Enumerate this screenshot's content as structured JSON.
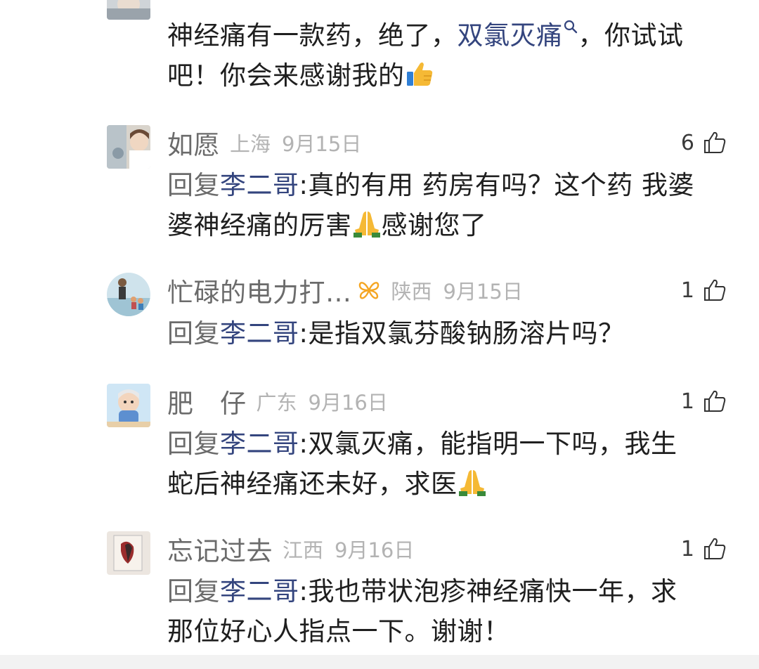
{
  "top_comment": {
    "text_a": "神经痛有一款药，绝了，",
    "drug_link": "双氯灭痛",
    "text_b": "，你试试",
    "text_c": "吧！你会来感谢我的"
  },
  "replies": [
    {
      "username": "如愿",
      "region": "上海",
      "date": "9月15日",
      "likes": "6",
      "reply_prefix": "回复",
      "reply_target": "李二哥",
      "text_line1": ":真的有用 药房有吗？这个药 我婆",
      "text_line2_a": "婆神经痛的厉害",
      "text_line2_b": "感谢您了"
    },
    {
      "username": "忙碌的电力打…",
      "region": "陕西",
      "date": "9月15日",
      "likes": "1",
      "reply_prefix": "回复",
      "reply_target": "李二哥",
      "text_line1": ":是指双氯芬酸钠肠溶片吗？"
    },
    {
      "username": "肥　仔",
      "region": "广东",
      "date": "9月16日",
      "likes": "1",
      "reply_prefix": "回复",
      "reply_target": "李二哥",
      "text_line1": ":双氯灭痛，能指明一下吗，我生",
      "text_line2_a": "蛇后神经痛还未好，求医"
    },
    {
      "username": "忘记过去",
      "region": "江西",
      "date": "9月16日",
      "likes": "1",
      "reply_prefix": "回复",
      "reply_target": "李二哥",
      "text_line1": ":我也带状泡疹神经痛快一年，求",
      "text_line2_a": "那位好心人指点一下。谢谢！"
    }
  ],
  "icons": {
    "like": "thumbs-up-outline-icon",
    "search": "search-icon",
    "badge": "butterfly-badge-icon",
    "thumbs_emoji": "thumbs-up-emoji",
    "pray_emoji": "praying-hands-emoji"
  },
  "colors": {
    "link": "#34457e",
    "username": "#6b6b6b",
    "meta": "#b3b3b3",
    "text": "#1f1f1f",
    "badge": "#f5a623"
  }
}
